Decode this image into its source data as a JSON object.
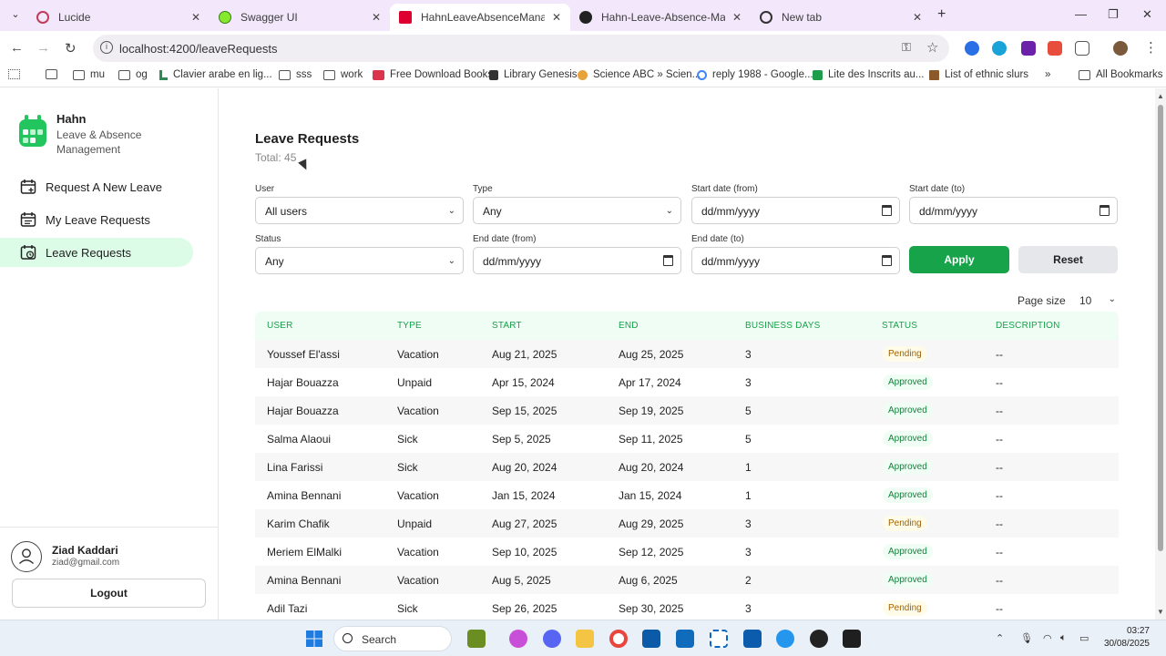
{
  "browser": {
    "tabs": [
      {
        "title": "Lucide",
        "icon": "lucide-icon",
        "color": "#c23b5a"
      },
      {
        "title": "Swagger UI",
        "icon": "swagger-icon",
        "color": "#85ea2d"
      },
      {
        "title": "HahnLeaveAbsenceManagement",
        "icon": "angular-icon",
        "color": "#dd0031",
        "active": true
      },
      {
        "title": "Hahn-Leave-Absence-Manager",
        "icon": "github-icon",
        "color": "#222222"
      },
      {
        "title": "New tab",
        "icon": "chrome-icon",
        "color": "#333333"
      }
    ],
    "url": "localhost:4200/leaveRequests",
    "bookmarks": [
      "mu",
      "og",
      "Clavier arabe en lig...",
      "sss",
      "work",
      "Free Download Books",
      "Library Genesis",
      "Science ABC » Scien...",
      "reply 1988 - Google...",
      "Lite des Inscrits au...",
      "List of ethnic slurs",
      "All Bookmarks"
    ]
  },
  "sidebar": {
    "app_name": "Hahn",
    "app_subtitle": "Leave & Absence Management",
    "items": [
      {
        "label": "Request A New Leave",
        "icon": "calendar-plus-icon"
      },
      {
        "label": "My Leave Requests",
        "icon": "calendar-list-icon"
      },
      {
        "label": "Leave Requests",
        "icon": "calendar-clock-icon",
        "active": true
      }
    ],
    "user": {
      "name": "Ziad Kaddari",
      "email": "ziad@gmail.com"
    },
    "logout_label": "Logout"
  },
  "main": {
    "title": "Leave Requests",
    "total": "Total: 45",
    "filters": {
      "user_label": "User",
      "user_value": "All users",
      "type_label": "Type",
      "type_value": "Any",
      "start_from_label": "Start date (from)",
      "start_from_value": "dd/mm/yyyy",
      "start_to_label": "Start date (to)",
      "start_to_value": "dd/mm/yyyy",
      "status_label": "Status",
      "status_value": "Any",
      "end_from_label": "End date (from)",
      "end_from_value": "dd/mm/yyyy",
      "end_to_label": "End date (to)",
      "end_to_value": "dd/mm/yyyy",
      "apply_label": "Apply",
      "reset_label": "Reset"
    },
    "page_size_label": "Page size",
    "page_size_value": "10",
    "table": {
      "headers": [
        "USER",
        "TYPE",
        "START",
        "END",
        "BUSINESS DAYS",
        "STATUS",
        "DESCRIPTION"
      ],
      "rows": [
        [
          "Youssef El'assi",
          "Vacation",
          "Aug 21, 2025",
          "Aug 25, 2025",
          "3",
          "Pending",
          "--"
        ],
        [
          "Hajar Bouazza",
          "Unpaid",
          "Apr 15, 2024",
          "Apr 17, 2024",
          "3",
          "Approved",
          "--"
        ],
        [
          "Hajar Bouazza",
          "Vacation",
          "Sep 15, 2025",
          "Sep 19, 2025",
          "5",
          "Approved",
          "--"
        ],
        [
          "Salma Alaoui",
          "Sick",
          "Sep 5, 2025",
          "Sep 11, 2025",
          "5",
          "Approved",
          "--"
        ],
        [
          "Lina Farissi",
          "Sick",
          "Aug 20, 2024",
          "Aug 20, 2024",
          "1",
          "Approved",
          "--"
        ],
        [
          "Amina Bennani",
          "Vacation",
          "Jan 15, 2024",
          "Jan 15, 2024",
          "1",
          "Approved",
          "--"
        ],
        [
          "Karim Chafik",
          "Unpaid",
          "Aug 27, 2025",
          "Aug 29, 2025",
          "3",
          "Pending",
          "--"
        ],
        [
          "Meriem ElMalki",
          "Vacation",
          "Sep 10, 2025",
          "Sep 12, 2025",
          "3",
          "Approved",
          "--"
        ],
        [
          "Amina Bennani",
          "Vacation",
          "Aug 5, 2025",
          "Aug 6, 2025",
          "2",
          "Approved",
          "--"
        ],
        [
          "Adil Tazi",
          "Sick",
          "Sep 26, 2025",
          "Sep 30, 2025",
          "3",
          "Pending",
          "--"
        ]
      ]
    }
  },
  "taskbar": {
    "search_label": "Search",
    "time": "03:27",
    "date": "30/08/2025"
  },
  "colors": {
    "accent": "#16a34a",
    "active_nav": "#dcfce7",
    "header_bg": "#f0fdf4"
  }
}
